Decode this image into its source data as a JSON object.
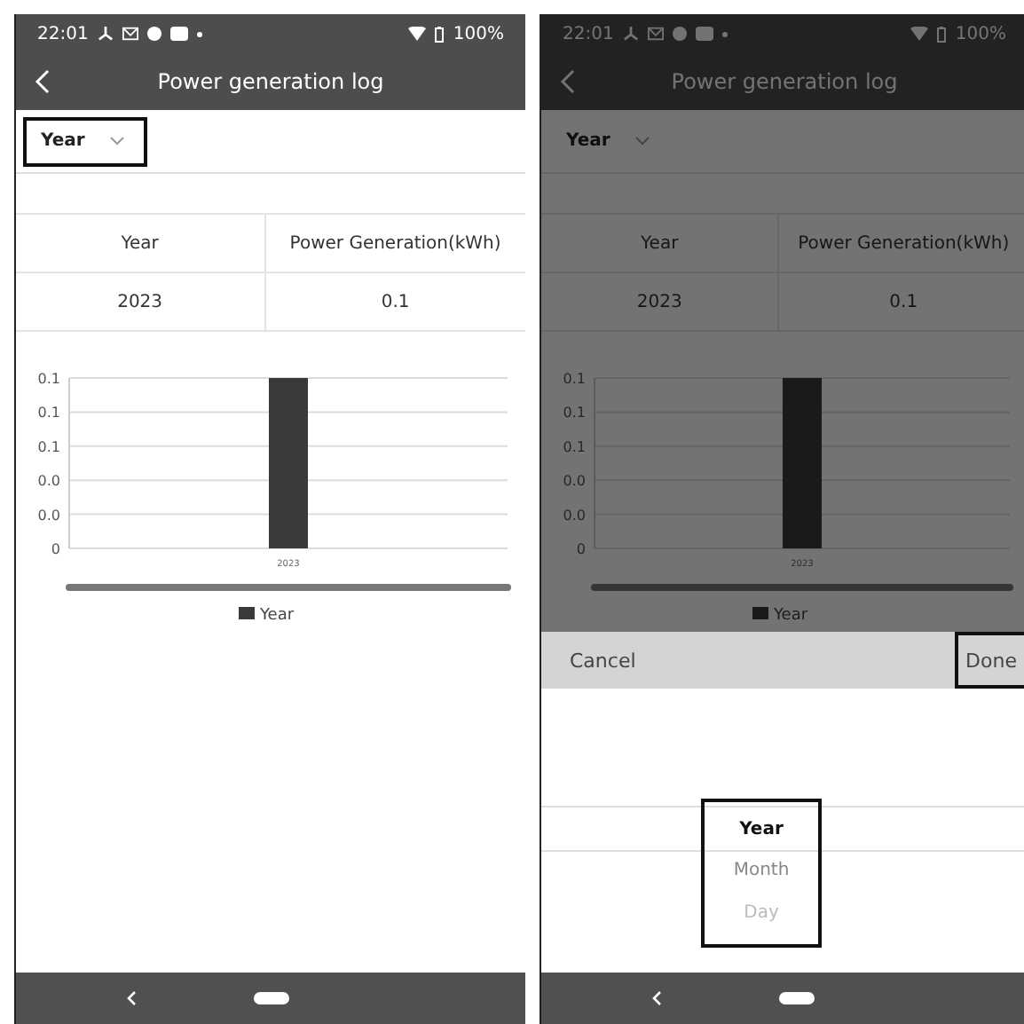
{
  "screens": [
    {
      "status_bar": {
        "time": "22:01",
        "battery": "100%"
      },
      "header": {
        "title": "Power generation log"
      },
      "period_dropdown": {
        "value": "Year",
        "highlighted": true
      },
      "table": {
        "columns": [
          "Year",
          "Power Generation(kWh)"
        ],
        "rows": [
          [
            "2023",
            "0.1"
          ]
        ]
      },
      "chart": {
        "chart_data": {
          "type": "bar",
          "grid": true,
          "categories": [
            "2023"
          ],
          "series": [
            {
              "name": "Year",
              "color": "#3a3a3a",
              "values": [
                0.1
              ]
            }
          ],
          "ylim": [
            0,
            0.1
          ],
          "yticks": [
            {
              "value": 0,
              "label": "0"
            },
            {
              "value": 0.02,
              "label": "0.0"
            },
            {
              "value": 0.04,
              "label": "0.0"
            },
            {
              "value": 0.06,
              "label": "0.1"
            },
            {
              "value": 0.08,
              "label": "0.1"
            },
            {
              "value": 0.1,
              "label": "0.1"
            }
          ]
        }
      }
    },
    {
      "dimmed": true,
      "status_bar": {
        "time": "22:01",
        "battery": "100%"
      },
      "header": {
        "title": "Power generation log"
      },
      "period_dropdown": {
        "value": "Year",
        "highlighted": false
      },
      "table": {
        "columns": [
          "Year",
          "Power Generation(kWh)"
        ],
        "rows": [
          [
            "2023",
            "0.1"
          ]
        ]
      },
      "chart": {
        "chart_data": {
          "type": "bar",
          "grid": true,
          "categories": [
            "2023"
          ],
          "series": [
            {
              "name": "Year",
              "color": "#3a3a3a",
              "values": [
                0.1
              ]
            }
          ],
          "ylim": [
            0,
            0.1
          ],
          "yticks": [
            {
              "value": 0,
              "label": "0"
            },
            {
              "value": 0.02,
              "label": "0.0"
            },
            {
              "value": 0.04,
              "label": "0.0"
            },
            {
              "value": 0.06,
              "label": "0.1"
            },
            {
              "value": 0.08,
              "label": "0.1"
            },
            {
              "value": 0.1,
              "label": "0.1"
            }
          ]
        }
      },
      "picker": {
        "cancel": "Cancel",
        "done": {
          "label": "Done",
          "highlighted": true
        },
        "highlighted": true,
        "items": [
          {
            "label": "Year",
            "selected": true
          },
          {
            "label": "Month",
            "selected": false
          },
          {
            "label": "Day",
            "selected": false
          }
        ]
      }
    }
  ]
}
